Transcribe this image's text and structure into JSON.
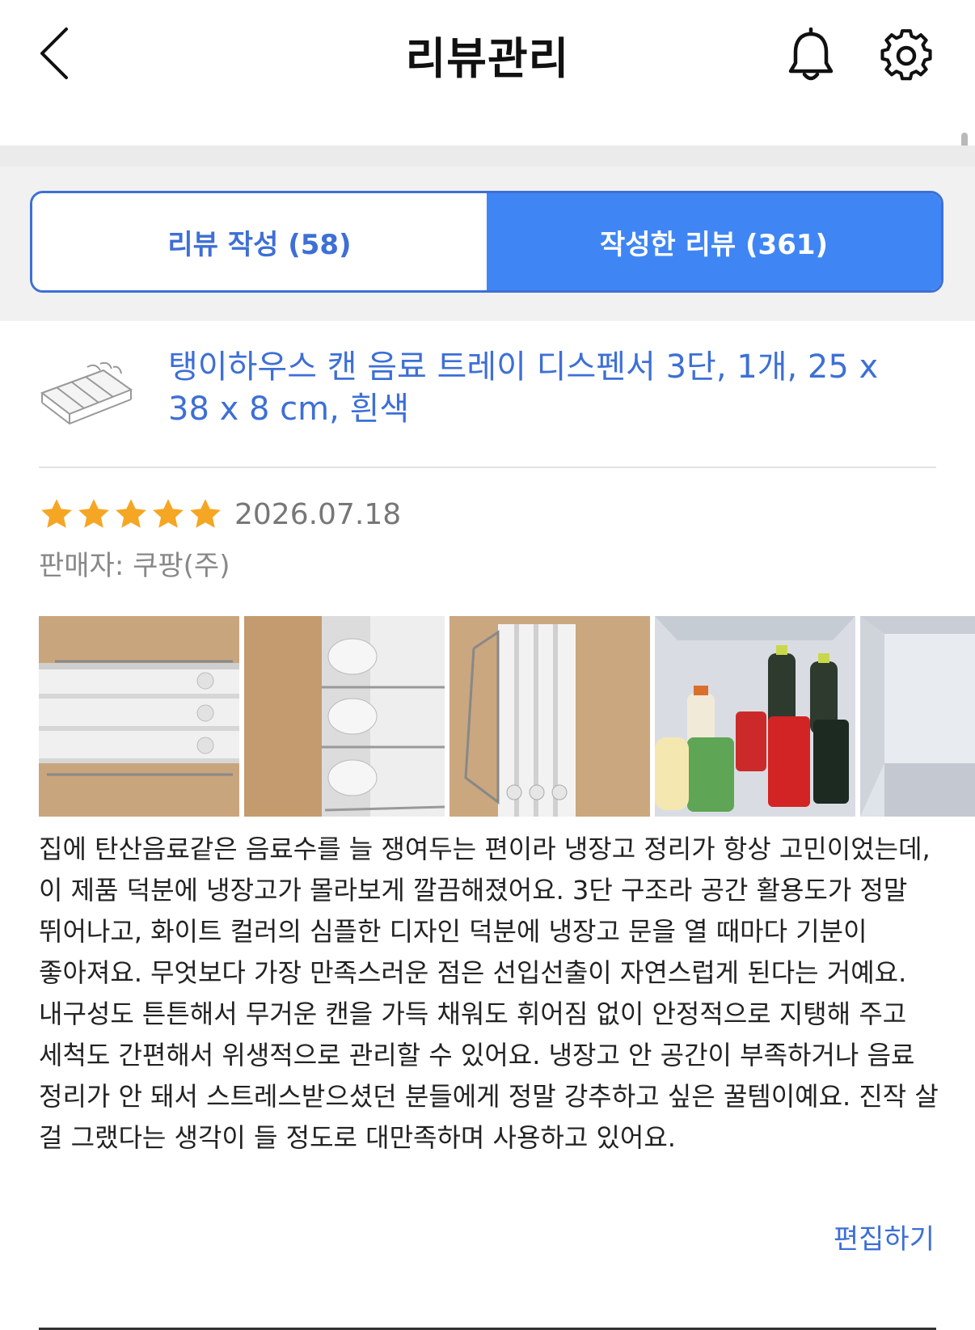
{
  "header": {
    "title": "리뷰관리"
  },
  "tabs": [
    {
      "label": "리뷰 작성 (58)",
      "active": false
    },
    {
      "label": "작성한 리뷰 (361)",
      "active": true
    }
  ],
  "product": {
    "name": "탱이하우스 캔 음료 트레이 디스펜서 3단, 1개, 25 x 38 x 8 cm, 흰색"
  },
  "review": {
    "rating": 5,
    "rating_max": 5,
    "date": "2026.07.18",
    "seller": "판매자: 쿠팡(주)",
    "text": "집에 탄산음료같은 음료수를 늘 쟁여두는 편이라 냉장고 정리가 항상 고민이었는데, 이 제품 덕분에 냉장고가 몰라보게 깔끔해졌어요. 3단 구조라 공간 활용도가 정말 뛰어나고, 화이트 컬러의 심플한 디자인 덕분에 냉장고 문을 열 때마다 기분이 좋아져요. 무엇보다 가장 만족스러운 점은 선입선출이 자연스럽게 된다는 거예요.\n내구성도 튼튼해서 무거운 캔을 가득 채워도 휘어짐 없이 안정적으로 지탱해 주고 세척도 간편해서 위생적으로 관리할 수 있어요. 냉장고 안 공간이 부족하거나 음료 정리가 안 돼서 스트레스받으셨던 분들에게 정말 강추하고 싶은 꿀템이예요. 진작 살 걸 그랬다는 생각이 들 정도로 대만족하며 사용하고 있어요.",
    "edit_label": "편집하기"
  },
  "icons": {
    "back": "chevron-left-icon",
    "bell": "bell-icon",
    "settings": "gear-icon",
    "star": "star-icon"
  },
  "colors": {
    "accent": "#3d6fd6",
    "tab_active_bg": "#3f86f4",
    "star": "#f5a623"
  }
}
